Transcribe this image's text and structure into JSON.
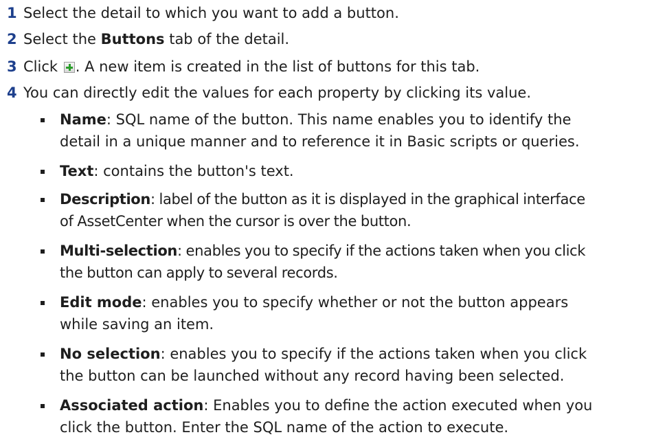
{
  "steps": [
    {
      "number": "1",
      "text": "Select the detail to which you want to add a button."
    },
    {
      "number": "2",
      "pre": "Select the ",
      "bold": "Buttons",
      "post": " tab of the detail."
    },
    {
      "number": "3",
      "pre": "Click ",
      "post": ". A new item is created in the list of buttons for this tab.",
      "icon": "add-plus-icon"
    },
    {
      "number": "4",
      "text": "You can directly edit the values for each property by clicking its value."
    }
  ],
  "properties": [
    {
      "term": "Name",
      "lines": [
        ": SQL name of the button. This name enables you to identify the",
        "detail in a unique manner and to reference it in Basic scripts or queries."
      ]
    },
    {
      "term": "Text",
      "lines": [
        ": contains the button's text."
      ]
    },
    {
      "term": "Description",
      "lines": [
        ": label of the button as it is displayed in the graphical interface",
        "of AssetCenter when the cursor is over the button."
      ]
    },
    {
      "term": "Multi-selection",
      "lines": [
        ": enables you to specify if the actions taken when you click",
        "the button can apply to several records."
      ]
    },
    {
      "term": "Edit mode",
      "lines": [
        ": enables you to specify whether or not the button appears",
        "while saving an item."
      ]
    },
    {
      "term": "No selection",
      "lines": [
        ": enables you to specify if the actions taken when you click",
        "the button can be launched without any record having been selected."
      ]
    },
    {
      "term": "Associated action",
      "lines": [
        ": Enables you to define the action executed when you",
        "click the button. Enter the SQL name of the action to execute."
      ]
    }
  ]
}
